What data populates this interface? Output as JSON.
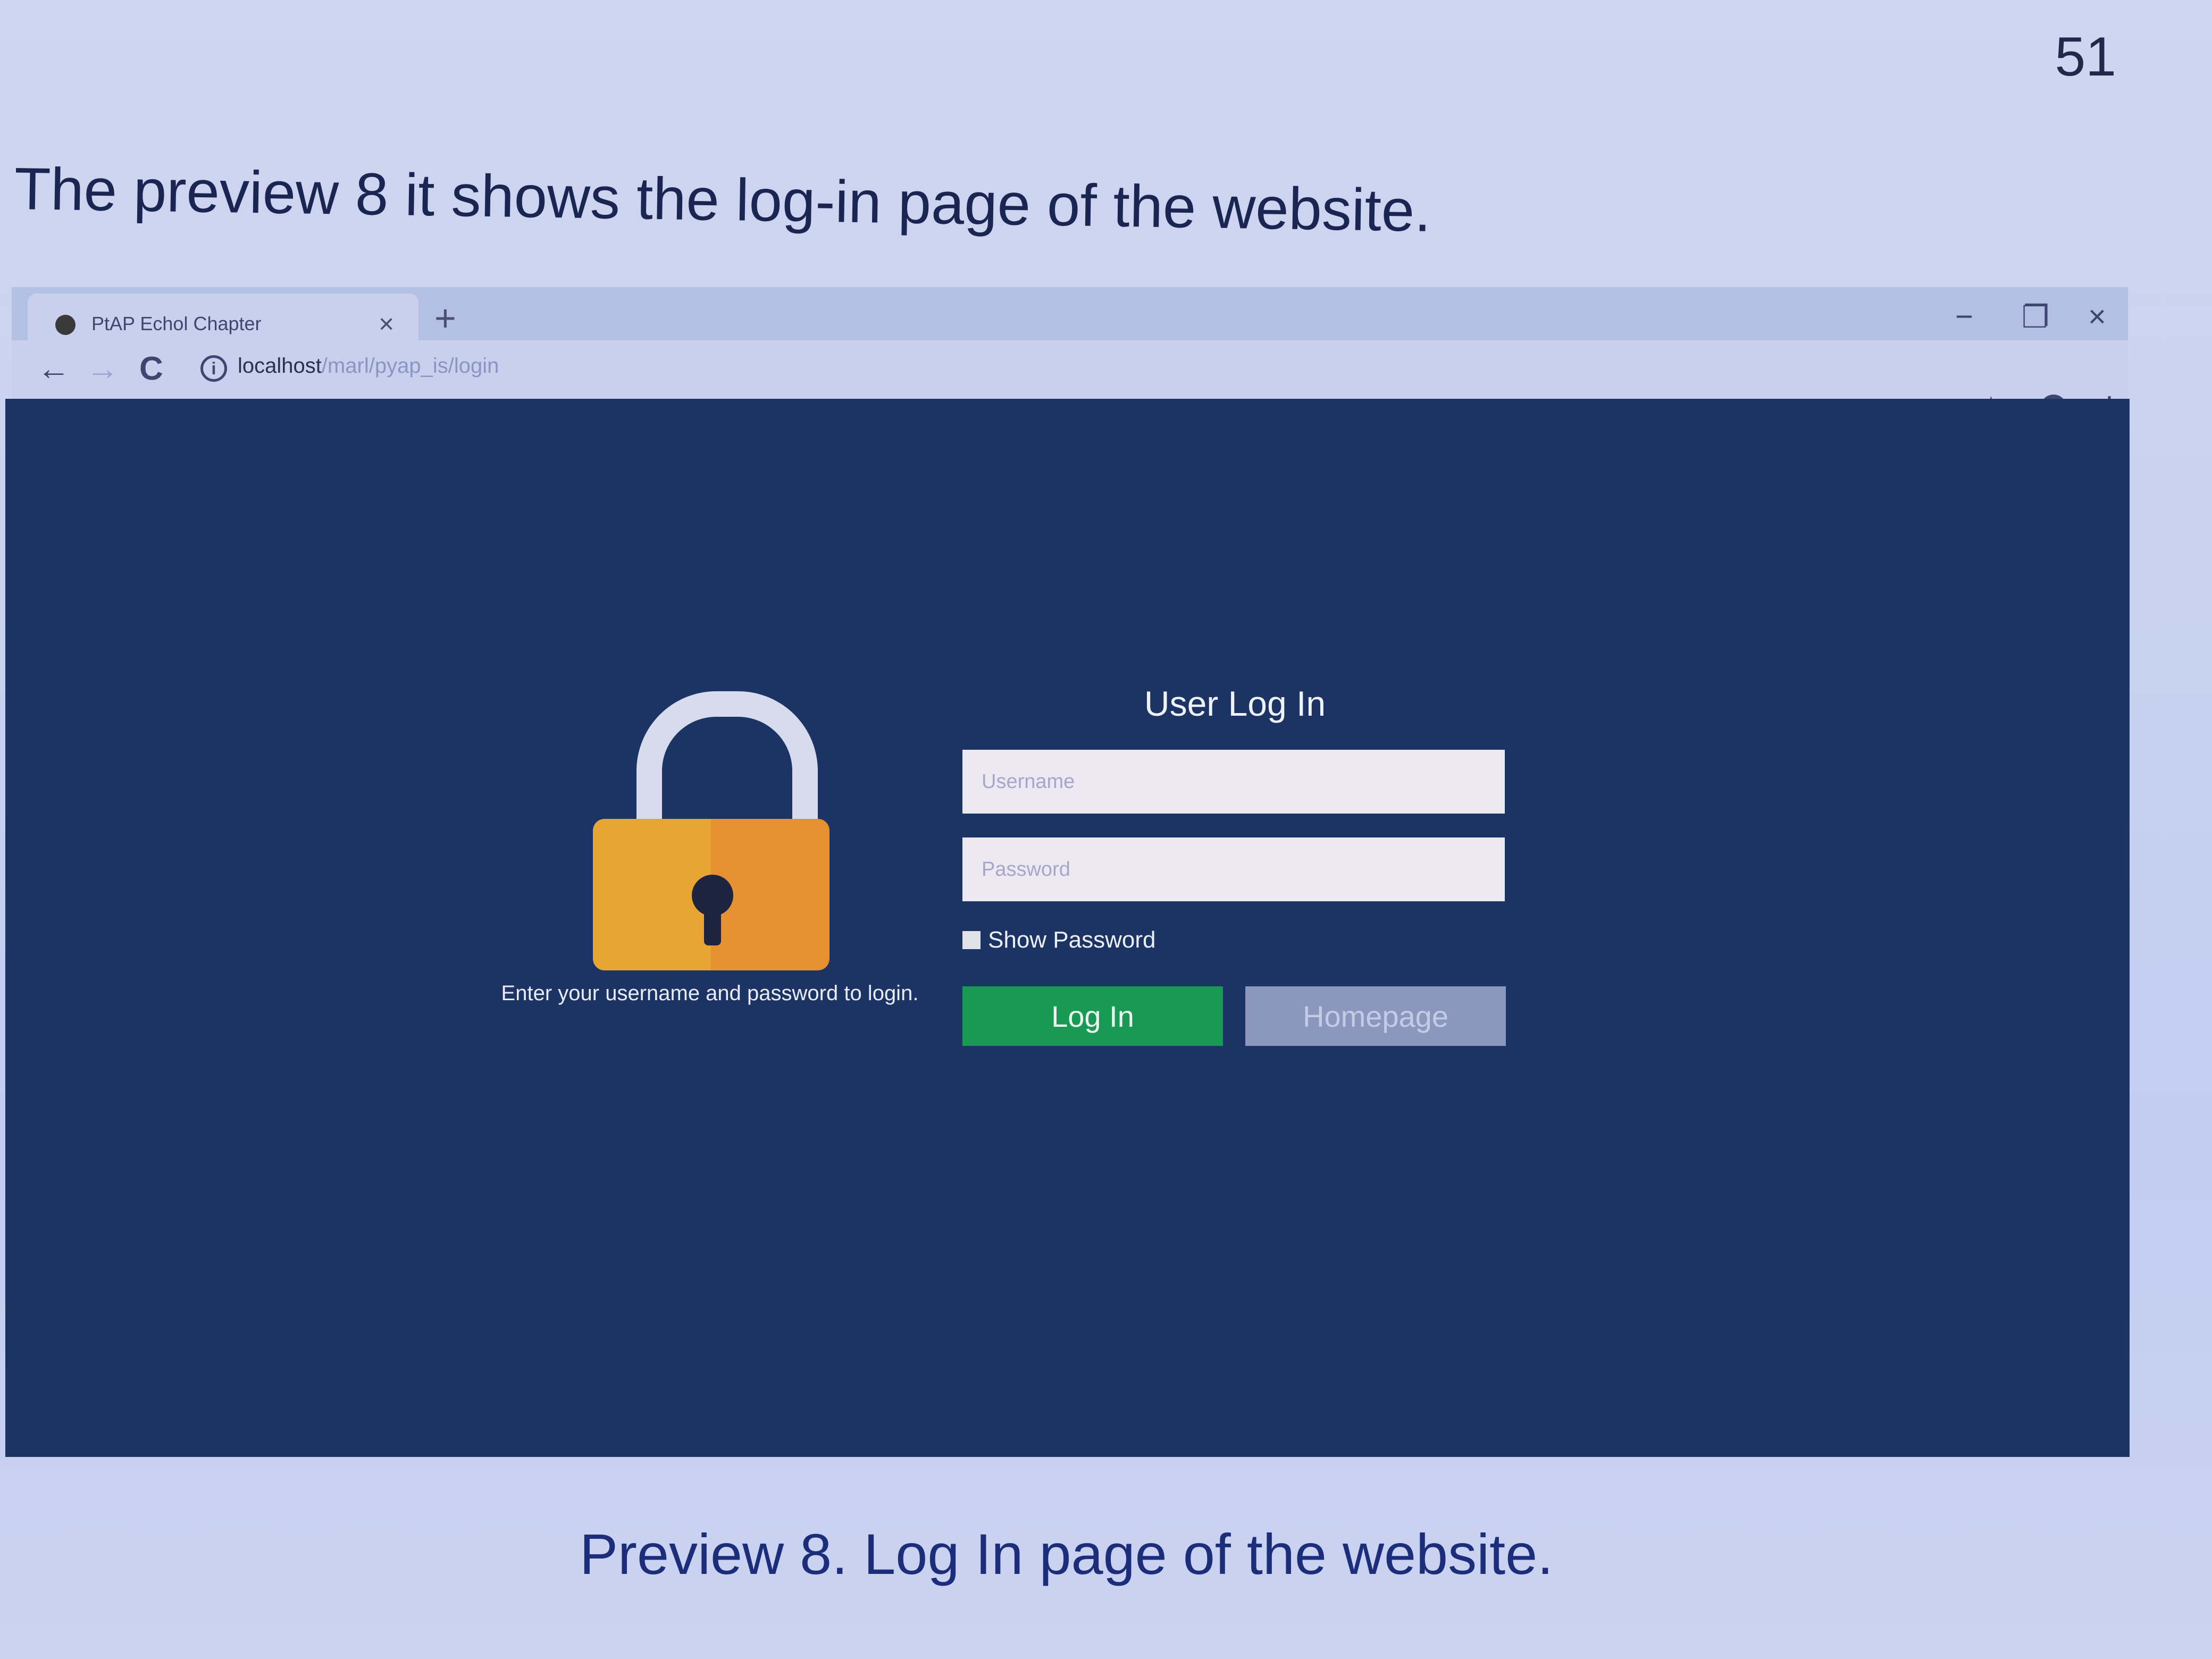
{
  "page": {
    "number": "51",
    "intro_text": "The preview 8 it shows the log-in page of the website.",
    "caption": "Preview 8. Log In page of the website."
  },
  "browser": {
    "tab_title": "PtAP Echol Chapter",
    "tab_close": "×",
    "new_tab": "+",
    "window_controls": {
      "minimize": "−",
      "restore": "❐",
      "close": "×"
    },
    "nav": {
      "back": "←",
      "forward": "→",
      "reload": "C",
      "info": "i"
    },
    "url_host": "localhost",
    "url_path": "/marl/pyap_is/login",
    "toolbar_icons": [
      "star-icon",
      "account-icon",
      "more-icon"
    ]
  },
  "login": {
    "title": "User Log In",
    "username_placeholder": "Username",
    "password_placeholder": "Password",
    "show_password_label": "Show Password",
    "login_button": "Log In",
    "homepage_button": "Homepage",
    "hint": "Enter your username and password to login."
  },
  "colors": {
    "background": "#1b3463",
    "login_button": "#189a55",
    "homepage_button": "#8b97bc",
    "lock_body": "#e8a533"
  }
}
